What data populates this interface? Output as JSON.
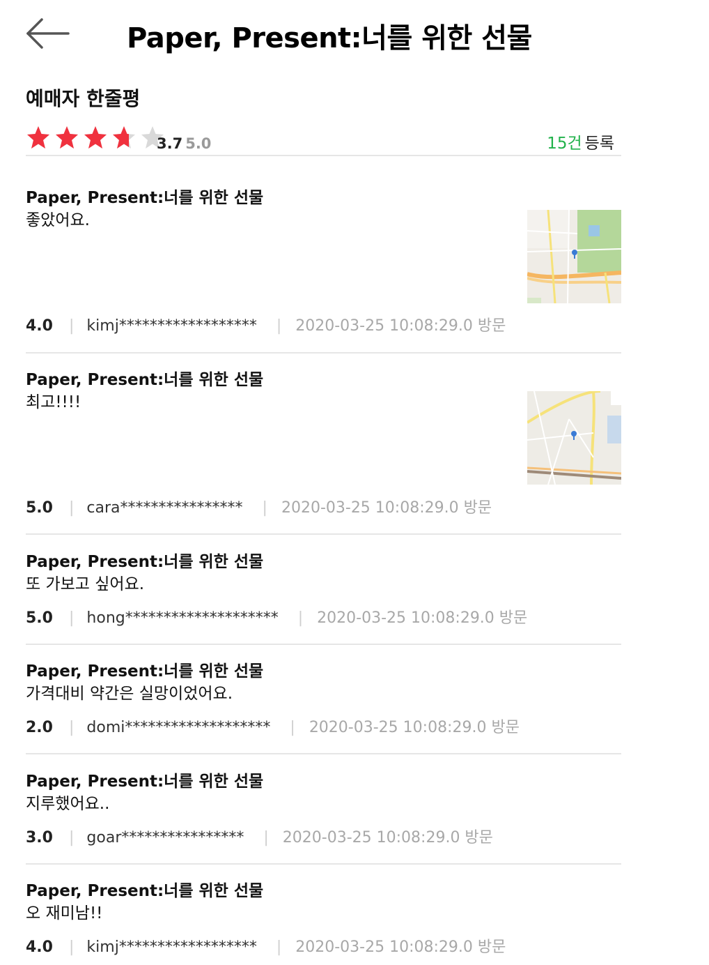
{
  "header": {
    "title": "Paper, Present:너를 위한 선물",
    "back_icon": "arrow-left-icon"
  },
  "summary": {
    "section_title": "예매자 한줄평",
    "stars_filled": 3.7,
    "stars_total": 5,
    "score": "3.7",
    "max_score": "5.0",
    "count_number": "15건",
    "count_label": "등록",
    "star_color": "#f0313e",
    "count_color": "#21b24b"
  },
  "reviews": [
    {
      "title": "Paper, Present:너를 위한 선물",
      "body": "좋았어요.",
      "rating": "4.0",
      "user": "kimj******************",
      "date": "2020-03-25 10:08:29.0 방문",
      "has_map": true
    },
    {
      "title": "Paper, Present:너를 위한 선물",
      "body": "최고!!!!",
      "rating": "5.0",
      "user": "cara****************",
      "date": "2020-03-25 10:08:29.0 방문",
      "has_map": true
    },
    {
      "title": "Paper, Present:너를 위한 선물",
      "body": "또 가보고 싶어요.",
      "rating": "5.0",
      "user": "hong********************",
      "date": "2020-03-25 10:08:29.0 방문",
      "has_map": false
    },
    {
      "title": "Paper, Present:너를 위한 선물",
      "body": "가격대비 약간은 실망이었어요.",
      "rating": "2.0",
      "user": "domi*******************",
      "date": "2020-03-25 10:08:29.0 방문",
      "has_map": false
    },
    {
      "title": "Paper, Present:너를 위한 선물",
      "body": "지루했어요..",
      "rating": "3.0",
      "user": "goar****************",
      "date": "2020-03-25 10:08:29.0 방문",
      "has_map": false
    },
    {
      "title": "Paper, Present:너를 위한 선물",
      "body": "오 재미남!!",
      "rating": "4.0",
      "user": "kimj******************",
      "date": "2020-03-25 10:08:29.0 방문",
      "has_map": false
    }
  ]
}
